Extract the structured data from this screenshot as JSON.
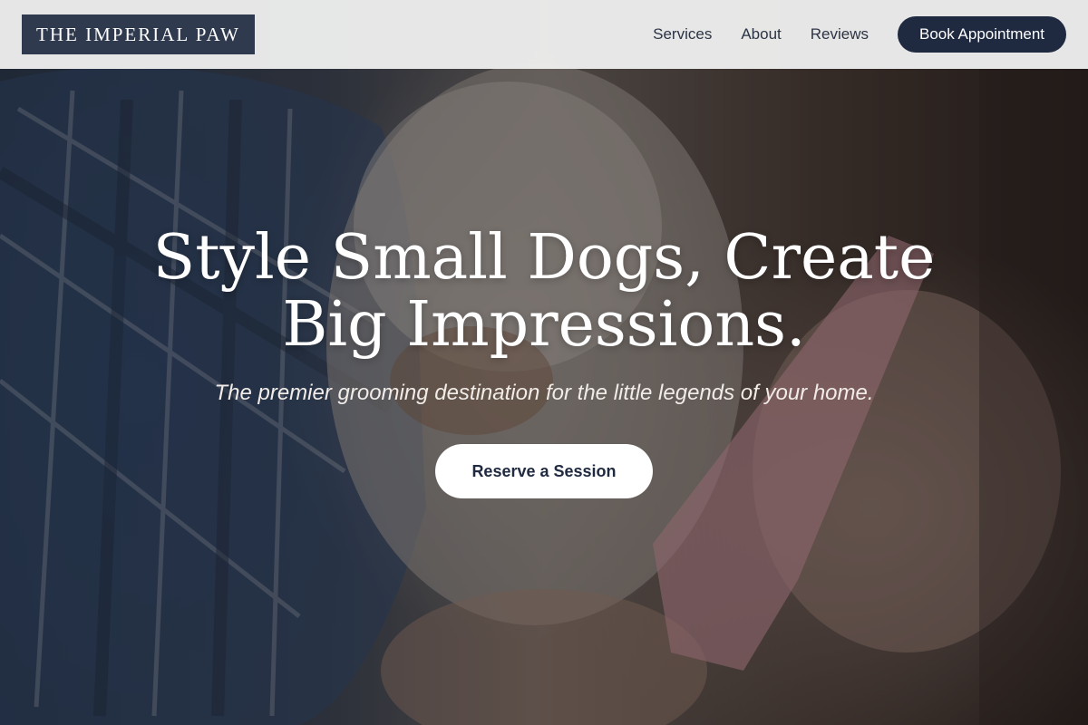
{
  "header": {
    "logo_text": "THE IMPERIAL PAW",
    "nav": [
      {
        "label": "Services"
      },
      {
        "label": "About"
      },
      {
        "label": "Reviews"
      }
    ],
    "cta_label": "Book Appointment"
  },
  "hero": {
    "headline_line1": "Style Small Dogs, Create",
    "headline_line2": "Big Impressions.",
    "subheadline": "The premier grooming destination for the little legends of your home.",
    "cta_label": "Reserve a Session",
    "background_image": "dog-grooming-photo"
  },
  "colors": {
    "brand_navy": "#1f2940",
    "logo_bg": "#2f3a4e",
    "header_bg": "#eeeeee",
    "text_white": "#ffffff"
  }
}
